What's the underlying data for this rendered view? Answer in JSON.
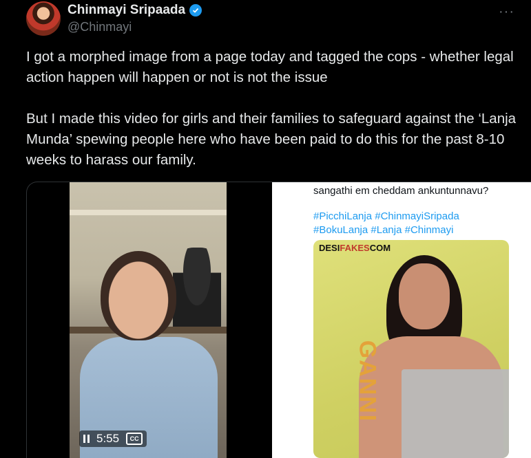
{
  "author": {
    "display_name": "Chinmayi Sripaada",
    "handle": "@Chinmayi",
    "verified": true
  },
  "more_label": "···",
  "tweet": {
    "paragraph_1": "I got a morphed image from a page today and tagged the cops - whether legal action happen will happen or not is not the issue",
    "paragraph_2": "But I made this video for girls and their families to safeguard against the ‘Lanja Munda’ spewing people here who have been paid to do this for the past 8-10 weeks to harass our family."
  },
  "video": {
    "time": "5:55",
    "cc_label": "CC"
  },
  "screenshot": {
    "text": "sangathi em cheddam ankuntunnavu?",
    "hashtags_line1": "#PicchiLanja #ChinmayiSripada",
    "hashtags_line2": "#BokuLanja #Lanja #Chinmayi",
    "logo_part1": "DESI",
    "logo_part2": "FAKES",
    "logo_part3": "COM",
    "overlay_word": "GANNI"
  },
  "colors": {
    "background": "#000000",
    "accent": "#1d9bf0",
    "text": "#e7e9ea",
    "muted": "#71767b"
  }
}
